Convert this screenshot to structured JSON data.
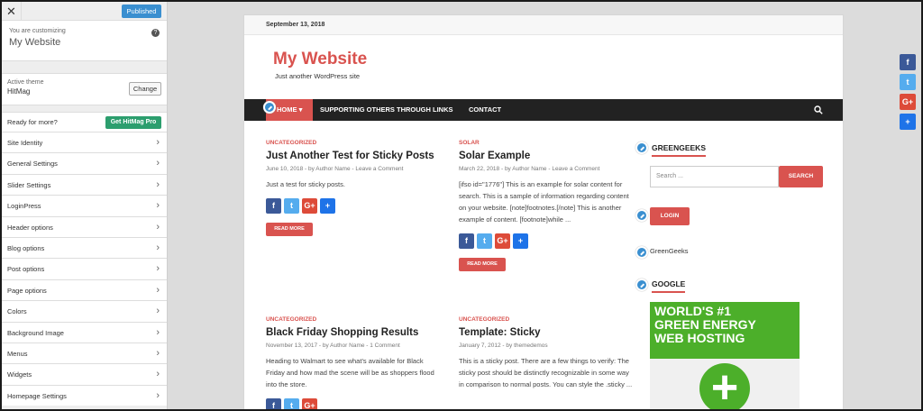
{
  "sidebar": {
    "close_label": "✕",
    "published_label": "Published",
    "customizing_label": "You are customizing",
    "site_name": "My Website",
    "help_label": "?",
    "active_theme_label": "Active theme",
    "theme_name": "HitMag",
    "change_label": "Change",
    "ready_label": "Ready for more?",
    "get_pro_label": "Get HitMag Pro",
    "menu": [
      "Site Identity",
      "General Settings",
      "Slider Settings",
      "LoginPress",
      "Header options",
      "Blog options",
      "Post options",
      "Page options",
      "Colors",
      "Background Image",
      "Menus",
      "Widgets",
      "Homepage Settings"
    ]
  },
  "preview": {
    "date": "September 13, 2018",
    "site_title": "My Website",
    "site_description": "Just another WordPress site",
    "nav": {
      "home": "HOME",
      "item2": "SUPPORTING OTHERS THROUGH LINKS",
      "item3": "CONTACT"
    },
    "posts": [
      {
        "category": "UNCATEGORIZED",
        "title": "Just Another Test for Sticky Posts",
        "meta": "June 10, 2018 - by Author Name - Leave a Comment",
        "excerpt": "Just a test for sticky posts.",
        "read_more": "READ MORE"
      },
      {
        "category": "SOLAR",
        "title": "Solar Example",
        "meta": "March 22, 2018 - by Author Name - Leave a Comment",
        "excerpt": "[ifso id=\"1776\"] This is an example for solar content for search. This is a sample of information regarding content on your website. [note]footnotes.[/note] This is another example of content. [footnote]while ...",
        "read_more": "READ MORE"
      },
      {
        "category": "UNCATEGORIZED",
        "title": "Black Friday Shopping Results",
        "meta": "November 13, 2017 - by Author Name - 1 Comment",
        "excerpt": "Heading to Walmart to see what's available for Black Friday and how mad the scene will be as shoppers flood into the store."
      },
      {
        "category": "UNCATEGORIZED",
        "title": "Template: Sticky",
        "meta": "January 7, 2012 - by themedemos",
        "excerpt": "This is a sticky post. There are a few things to verify: The sticky post should be distinctly recognizable in some way in comparison to normal posts. You can style the .sticky ..."
      }
    ],
    "widgets": {
      "greengeeks_title": "GREENGEEKS",
      "search_placeholder": "Search ...",
      "search_button": "SEARCH",
      "login_button": "LOGIN",
      "link_label": "GreenGeeks",
      "google_title": "GOOGLE",
      "ad_line1": "WORLD'S #1",
      "ad_line2": "GREEN ENERGY",
      "ad_line3": "WEB HOSTING"
    }
  },
  "share_icons": {
    "facebook": "f",
    "twitter": "t",
    "googleplus": "G+",
    "add": "+"
  },
  "colors": {
    "accent": "#d9534f",
    "facebook": "#3b5998",
    "twitter": "#55acee",
    "googleplus": "#dd4b39",
    "add": "#1e73e8",
    "green": "#4caf2a"
  }
}
